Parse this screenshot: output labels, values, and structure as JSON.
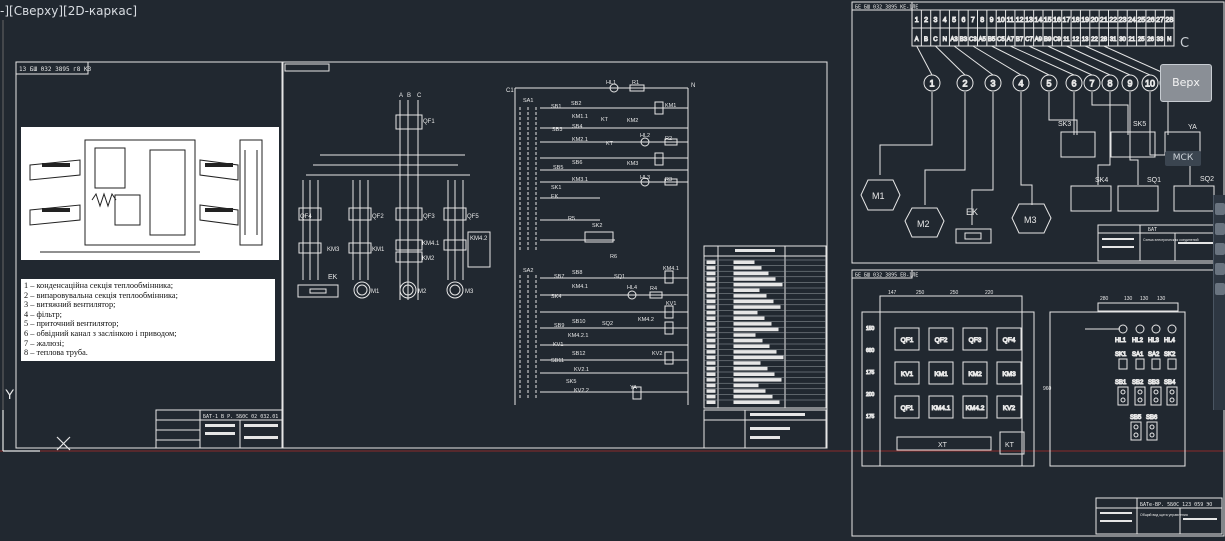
{
  "viewport": {
    "label_parts": [
      "-]",
      "[Сверху]",
      "[2D-каркас]"
    ]
  },
  "viewcube": {
    "face_label": "Верх",
    "compass_letter": "С",
    "wcs_label": "МСК"
  },
  "axes": {
    "y_label": "Y"
  },
  "sheet1": {
    "stamp_top": "13 БШ 032 3895 г8 КЗ",
    "drawing_code": "БАТ-1 В Р. 5Б0С 02 032.01",
    "legend_lines": [
      "1 – конденсаційна секція теплообмінника;",
      "2 – випаровувальна секція теплообмінника;",
      "3 – витяжний вентилятор;",
      "4 – фільтр;",
      "5 – приточний вентилятор;",
      "6 – обвідний канал з заслінкою і приводом;",
      "7 – жалюзі;",
      "8 – теплова труба."
    ]
  },
  "sheet2": {
    "power": {
      "phases": [
        "A",
        "B",
        "C"
      ],
      "breaker_main": "QF1",
      "breakers": [
        "QF4",
        "QF2",
        "QF3",
        "QF5"
      ],
      "contactors": [
        "KM3",
        "KM1",
        "KM4.1",
        "KM4.2"
      ],
      "contactor_km2": "KM2",
      "heater": "EK",
      "motors": [
        "M1",
        "M2",
        "M3"
      ]
    },
    "control": {
      "rail_c": "C1",
      "rail_n": "N",
      "labels_top": [
        "SA1",
        "SB1",
        "SB2",
        "HL1",
        "R1",
        "KM1",
        "SB3",
        "KM1.1",
        "SB4",
        "KT",
        "KM2",
        "HL2",
        "R2",
        "KM2.1",
        "KT",
        "SB5",
        "SB6",
        "KM3",
        "HL3",
        "R3",
        "KM3.1",
        "SK1",
        "SK2",
        "R5",
        "R6",
        "EK"
      ],
      "labels_bottom": [
        "SA2",
        "SB7",
        "SB8",
        "SQ1",
        "KM4.1",
        "KM4.1",
        "HL4",
        "R4",
        "SK4",
        "KV1",
        "SB9",
        "SB10",
        "SQ2",
        "KM4.2",
        "KM4.2.1",
        "KV1",
        "SB12",
        "KV2",
        "SB11",
        "KV2.1",
        "SK5",
        "KV2.2",
        "YA"
      ]
    }
  },
  "sheet3": {
    "stamp_top": "БЕ БШ 032 3895 КЕ-1ЛЕ",
    "terminal_numbers": [
      "1",
      "2",
      "3",
      "4",
      "5",
      "6",
      "7",
      "8",
      "9",
      "10",
      "11",
      "12",
      "13",
      "14",
      "15",
      "16",
      "17",
      "18",
      "19",
      "20",
      "21",
      "22",
      "23",
      "24",
      "25",
      "26",
      "27",
      "28"
    ],
    "terminal_phases": [
      "A",
      "B",
      "C",
      "N",
      "A3",
      "B3",
      "C3",
      "A5",
      "B5",
      "C5",
      "A7",
      "B7",
      "C7",
      "A9",
      "B9",
      "C9",
      "11",
      "12",
      "13",
      "22",
      "28",
      "31",
      "30",
      "21",
      "25",
      "26",
      "33",
      "N"
    ],
    "wire_numbers": [
      "1",
      "2",
      "3",
      "4",
      "5",
      "6",
      "7",
      "8",
      "9",
      "10",
      "11"
    ],
    "devices": [
      "M1",
      "M2",
      "EK",
      "M3",
      "SK3",
      "SK5",
      "SK4",
      "SQ1",
      "SQ2",
      "YA"
    ],
    "title_code": "БАТ",
    "title_text": "Схема электрическая соединений"
  },
  "sheet4": {
    "stamp_top": "БЕ БШ 032 3895 ЕВ-1ЛЕ",
    "dims_top": [
      "147",
      "250",
      "250",
      "220"
    ],
    "panel_cells": [
      "QF1",
      "QF2",
      "QF3",
      "QF4",
      "KV1",
      "KM1",
      "KM2",
      "KM3",
      "QF1",
      "KM4.1",
      "KM4.2",
      "KV2"
    ],
    "bar_xt": "XT",
    "kt_box": "KT",
    "dims_left": [
      "150",
      "680",
      "175",
      "200",
      "175"
    ],
    "door_dims": [
      "280",
      "130",
      "130",
      "130"
    ],
    "door_leds": [
      "HL1",
      "HL2",
      "HL3",
      "HL4"
    ],
    "door_switches": [
      "SK1",
      "SA1",
      "SA2",
      "SK2"
    ],
    "door_buttons_row1": [
      "SB1",
      "SB2",
      "SB3",
      "SB4"
    ],
    "door_buttons_row2": [
      "SB5",
      "SB6"
    ],
    "door_height": "960",
    "title_code": "БАТе-ВР. 5Б0С 123 059 ЭО",
    "title_text": "Общий вид щита управления"
  },
  "colors": {
    "background": "#212830",
    "lines": "#e6e6e6",
    "red_axis": "#b03030",
    "text": "#e8e8e8"
  }
}
